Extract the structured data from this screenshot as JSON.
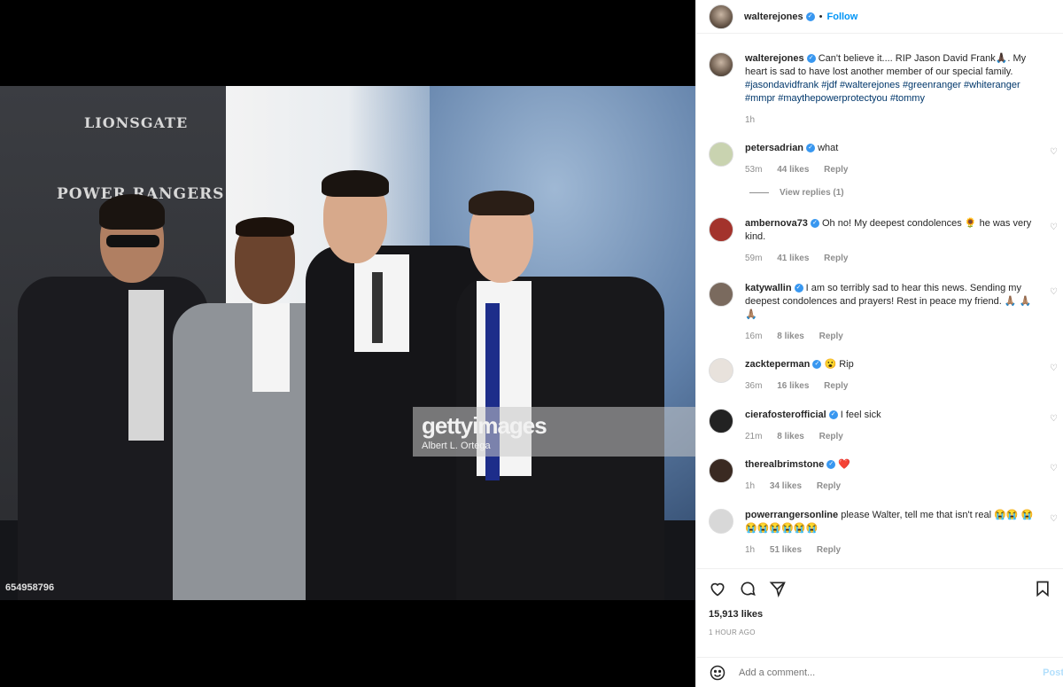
{
  "post": {
    "username": "walterejones",
    "follow_label": "Follow",
    "dot": "•"
  },
  "photo": {
    "watermark_brand": "gettyimages",
    "watermark_credit": "Albert L. Ortega",
    "photo_id": "654958796",
    "sponsors": [
      "LIONSGATE",
      "POWER RANGERS"
    ]
  },
  "caption": {
    "username": "walterejones",
    "text": "Can't believe it.... RIP Jason David Frank🙏🏿. My heart is sad to have lost another member of our special family.",
    "hashtags": "#jasondavidfrank #jdf #walterejones #greenranger #whiteranger #mmpr #maythepowerprotectyou #tommy",
    "age": "1h"
  },
  "comments": [
    {
      "username": "petersadrian",
      "text": "what",
      "age": "53m",
      "likes": "44 likes",
      "reply": "Reply"
    },
    {
      "username": "ambernova73",
      "text": "Oh no! My deepest condolences 🌻 he was very kind.",
      "age": "59m",
      "likes": "41 likes",
      "reply": "Reply"
    },
    {
      "username": "katywallin",
      "text": "I am so terribly sad to hear this news. Sending my deepest condolences and prayers! Rest in peace my friend. 🙏🏽 🙏🏽🙏🏽",
      "age": "16m",
      "likes": "8 likes",
      "reply": "Reply"
    },
    {
      "username": "zackteperman",
      "text": "😮 Rip",
      "age": "36m",
      "likes": "16 likes",
      "reply": "Reply"
    },
    {
      "username": "cierafosterofficial",
      "text": "I feel sick",
      "age": "21m",
      "likes": "8 likes",
      "reply": "Reply"
    },
    {
      "username": "therealbrimstone",
      "text": "❤️",
      "age": "1h",
      "likes": "34 likes",
      "reply": "Reply"
    },
    {
      "username": "powerrangersonline",
      "text": "please Walter, tell me that isn't real 😭😭 😭😭😭😭😭😭😭",
      "age": "1h",
      "likes": "51 likes",
      "reply": "Reply"
    }
  ],
  "view_replies": "View replies (1)",
  "likes_count": "15,913 likes",
  "timestamp": "1 HOUR AGO",
  "add_comment": {
    "placeholder": "Add a comment...",
    "post_label": "Post"
  },
  "colors": {
    "link_blue": "#0095f6",
    "hashtag": "#00376b",
    "muted": "#8e8e8e",
    "verified": "#3897f0"
  }
}
